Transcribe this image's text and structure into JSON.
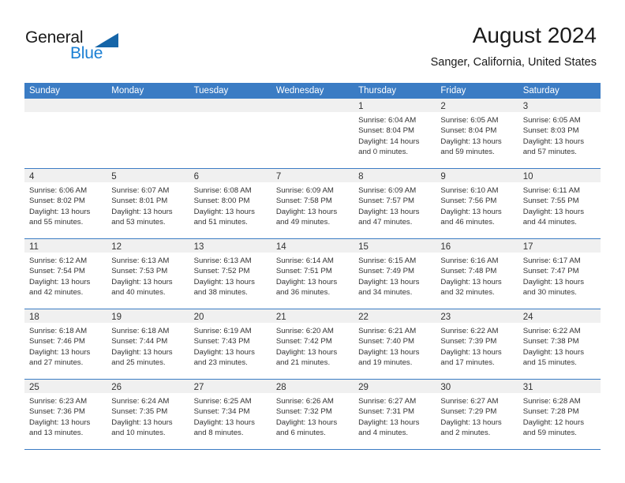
{
  "brand": {
    "name_part1": "General",
    "name_part2": "Blue"
  },
  "header": {
    "title": "August 2024",
    "subtitle": "Sanger, California, United States"
  },
  "colors": {
    "header_blue": "#3b7cc4",
    "logo_blue": "#1a7fd4",
    "triangle_blue": "#1565a8",
    "cell_head_gray": "#f0f0f0"
  },
  "calendar": {
    "day_names": [
      "Sunday",
      "Monday",
      "Tuesday",
      "Wednesday",
      "Thursday",
      "Friday",
      "Saturday"
    ],
    "weeks": [
      [
        {
          "day": "",
          "sunrise": "",
          "sunset": "",
          "daylight": "",
          "daylight2": ""
        },
        {
          "day": "",
          "sunrise": "",
          "sunset": "",
          "daylight": "",
          "daylight2": ""
        },
        {
          "day": "",
          "sunrise": "",
          "sunset": "",
          "daylight": "",
          "daylight2": ""
        },
        {
          "day": "",
          "sunrise": "",
          "sunset": "",
          "daylight": "",
          "daylight2": ""
        },
        {
          "day": "1",
          "sunrise": "Sunrise: 6:04 AM",
          "sunset": "Sunset: 8:04 PM",
          "daylight": "Daylight: 14 hours",
          "daylight2": "and 0 minutes."
        },
        {
          "day": "2",
          "sunrise": "Sunrise: 6:05 AM",
          "sunset": "Sunset: 8:04 PM",
          "daylight": "Daylight: 13 hours",
          "daylight2": "and 59 minutes."
        },
        {
          "day": "3",
          "sunrise": "Sunrise: 6:05 AM",
          "sunset": "Sunset: 8:03 PM",
          "daylight": "Daylight: 13 hours",
          "daylight2": "and 57 minutes."
        }
      ],
      [
        {
          "day": "4",
          "sunrise": "Sunrise: 6:06 AM",
          "sunset": "Sunset: 8:02 PM",
          "daylight": "Daylight: 13 hours",
          "daylight2": "and 55 minutes."
        },
        {
          "day": "5",
          "sunrise": "Sunrise: 6:07 AM",
          "sunset": "Sunset: 8:01 PM",
          "daylight": "Daylight: 13 hours",
          "daylight2": "and 53 minutes."
        },
        {
          "day": "6",
          "sunrise": "Sunrise: 6:08 AM",
          "sunset": "Sunset: 8:00 PM",
          "daylight": "Daylight: 13 hours",
          "daylight2": "and 51 minutes."
        },
        {
          "day": "7",
          "sunrise": "Sunrise: 6:09 AM",
          "sunset": "Sunset: 7:58 PM",
          "daylight": "Daylight: 13 hours",
          "daylight2": "and 49 minutes."
        },
        {
          "day": "8",
          "sunrise": "Sunrise: 6:09 AM",
          "sunset": "Sunset: 7:57 PM",
          "daylight": "Daylight: 13 hours",
          "daylight2": "and 47 minutes."
        },
        {
          "day": "9",
          "sunrise": "Sunrise: 6:10 AM",
          "sunset": "Sunset: 7:56 PM",
          "daylight": "Daylight: 13 hours",
          "daylight2": "and 46 minutes."
        },
        {
          "day": "10",
          "sunrise": "Sunrise: 6:11 AM",
          "sunset": "Sunset: 7:55 PM",
          "daylight": "Daylight: 13 hours",
          "daylight2": "and 44 minutes."
        }
      ],
      [
        {
          "day": "11",
          "sunrise": "Sunrise: 6:12 AM",
          "sunset": "Sunset: 7:54 PM",
          "daylight": "Daylight: 13 hours",
          "daylight2": "and 42 minutes."
        },
        {
          "day": "12",
          "sunrise": "Sunrise: 6:13 AM",
          "sunset": "Sunset: 7:53 PM",
          "daylight": "Daylight: 13 hours",
          "daylight2": "and 40 minutes."
        },
        {
          "day": "13",
          "sunrise": "Sunrise: 6:13 AM",
          "sunset": "Sunset: 7:52 PM",
          "daylight": "Daylight: 13 hours",
          "daylight2": "and 38 minutes."
        },
        {
          "day": "14",
          "sunrise": "Sunrise: 6:14 AM",
          "sunset": "Sunset: 7:51 PM",
          "daylight": "Daylight: 13 hours",
          "daylight2": "and 36 minutes."
        },
        {
          "day": "15",
          "sunrise": "Sunrise: 6:15 AM",
          "sunset": "Sunset: 7:49 PM",
          "daylight": "Daylight: 13 hours",
          "daylight2": "and 34 minutes."
        },
        {
          "day": "16",
          "sunrise": "Sunrise: 6:16 AM",
          "sunset": "Sunset: 7:48 PM",
          "daylight": "Daylight: 13 hours",
          "daylight2": "and 32 minutes."
        },
        {
          "day": "17",
          "sunrise": "Sunrise: 6:17 AM",
          "sunset": "Sunset: 7:47 PM",
          "daylight": "Daylight: 13 hours",
          "daylight2": "and 30 minutes."
        }
      ],
      [
        {
          "day": "18",
          "sunrise": "Sunrise: 6:18 AM",
          "sunset": "Sunset: 7:46 PM",
          "daylight": "Daylight: 13 hours",
          "daylight2": "and 27 minutes."
        },
        {
          "day": "19",
          "sunrise": "Sunrise: 6:18 AM",
          "sunset": "Sunset: 7:44 PM",
          "daylight": "Daylight: 13 hours",
          "daylight2": "and 25 minutes."
        },
        {
          "day": "20",
          "sunrise": "Sunrise: 6:19 AM",
          "sunset": "Sunset: 7:43 PM",
          "daylight": "Daylight: 13 hours",
          "daylight2": "and 23 minutes."
        },
        {
          "day": "21",
          "sunrise": "Sunrise: 6:20 AM",
          "sunset": "Sunset: 7:42 PM",
          "daylight": "Daylight: 13 hours",
          "daylight2": "and 21 minutes."
        },
        {
          "day": "22",
          "sunrise": "Sunrise: 6:21 AM",
          "sunset": "Sunset: 7:40 PM",
          "daylight": "Daylight: 13 hours",
          "daylight2": "and 19 minutes."
        },
        {
          "day": "23",
          "sunrise": "Sunrise: 6:22 AM",
          "sunset": "Sunset: 7:39 PM",
          "daylight": "Daylight: 13 hours",
          "daylight2": "and 17 minutes."
        },
        {
          "day": "24",
          "sunrise": "Sunrise: 6:22 AM",
          "sunset": "Sunset: 7:38 PM",
          "daylight": "Daylight: 13 hours",
          "daylight2": "and 15 minutes."
        }
      ],
      [
        {
          "day": "25",
          "sunrise": "Sunrise: 6:23 AM",
          "sunset": "Sunset: 7:36 PM",
          "daylight": "Daylight: 13 hours",
          "daylight2": "and 13 minutes."
        },
        {
          "day": "26",
          "sunrise": "Sunrise: 6:24 AM",
          "sunset": "Sunset: 7:35 PM",
          "daylight": "Daylight: 13 hours",
          "daylight2": "and 10 minutes."
        },
        {
          "day": "27",
          "sunrise": "Sunrise: 6:25 AM",
          "sunset": "Sunset: 7:34 PM",
          "daylight": "Daylight: 13 hours",
          "daylight2": "and 8 minutes."
        },
        {
          "day": "28",
          "sunrise": "Sunrise: 6:26 AM",
          "sunset": "Sunset: 7:32 PM",
          "daylight": "Daylight: 13 hours",
          "daylight2": "and 6 minutes."
        },
        {
          "day": "29",
          "sunrise": "Sunrise: 6:27 AM",
          "sunset": "Sunset: 7:31 PM",
          "daylight": "Daylight: 13 hours",
          "daylight2": "and 4 minutes."
        },
        {
          "day": "30",
          "sunrise": "Sunrise: 6:27 AM",
          "sunset": "Sunset: 7:29 PM",
          "daylight": "Daylight: 13 hours",
          "daylight2": "and 2 minutes."
        },
        {
          "day": "31",
          "sunrise": "Sunrise: 6:28 AM",
          "sunset": "Sunset: 7:28 PM",
          "daylight": "Daylight: 12 hours",
          "daylight2": "and 59 minutes."
        }
      ]
    ]
  }
}
